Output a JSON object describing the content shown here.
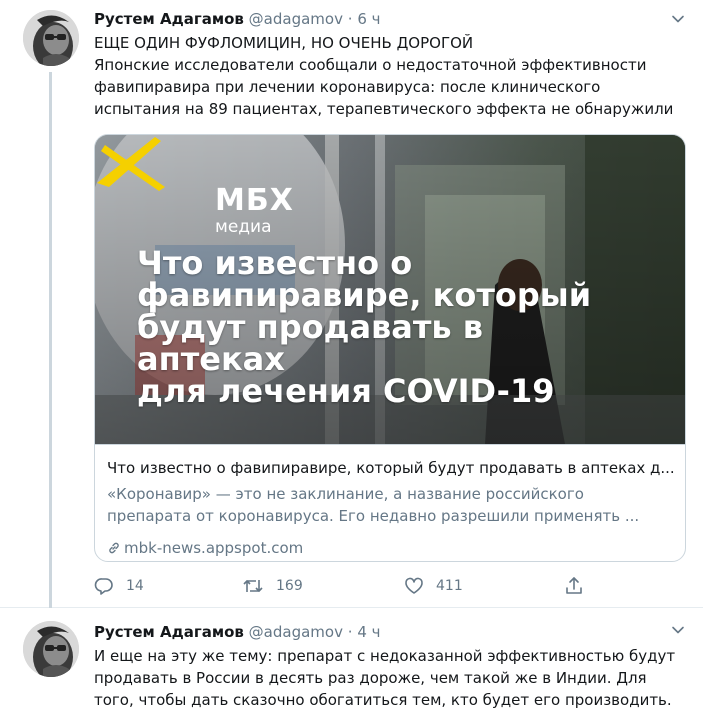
{
  "tweets": [
    {
      "author": {
        "name": "Рустем Адагамов",
        "handle": "@adagamov",
        "avatar": "avatar-photo"
      },
      "separator": "·",
      "time": "6 ч",
      "text": "ЕЩЕ ОДИН ФУФЛОМИЦИН, НО ОЧЕНЬ ДОРОГОЙ\nЯпонские исследователи сообщали о недостаточной эффективности фавипиравира при лечении коронавируса: после клинического испытания на 89 пациентах, терапевтического эффекта не обнаружили",
      "card": {
        "logo": {
          "word": "МБХ",
          "sub": "медиа"
        },
        "headline": "Что известно о\nфавипиравире, который\nбудут продавать в аптеках\nдля лечения COVID-19",
        "title": "Что известно о фавипиравире, который будут продавать в аптеках д...",
        "description": "«Коронавир» — это не заклинание, а название российского\nпрепарата от коронавируса. Его недавно разрешили применять ...",
        "link": "mbk-news.appspot.com",
        "link_icon": "link-icon"
      },
      "actions": {
        "reply_count": "14",
        "retweet_count": "169",
        "like_count": "411"
      },
      "icons": {
        "reply": "reply-icon",
        "retweet": "retweet-icon",
        "like": "heart-icon",
        "share": "share-icon",
        "more": "chevron-down-icon"
      }
    },
    {
      "author": {
        "name": "Рустем Адагамов",
        "handle": "@adagamov",
        "avatar": "avatar-photo"
      },
      "separator": "·",
      "time": "4 ч",
      "text": "И еще на эту же тему: препарат с недоказанной эффективностью будут\nпродавать в России в десять раз дороже, чем такой же в Индии. Для\nтого, чтобы дать сказочно обогатиться тем, кто будет его производить."
    }
  ],
  "colors": {
    "text": "#14171a",
    "secondary": "#657786",
    "border": "#ccd6dd",
    "divider": "#e6ecf0",
    "logo_accent": "#f5d000"
  }
}
